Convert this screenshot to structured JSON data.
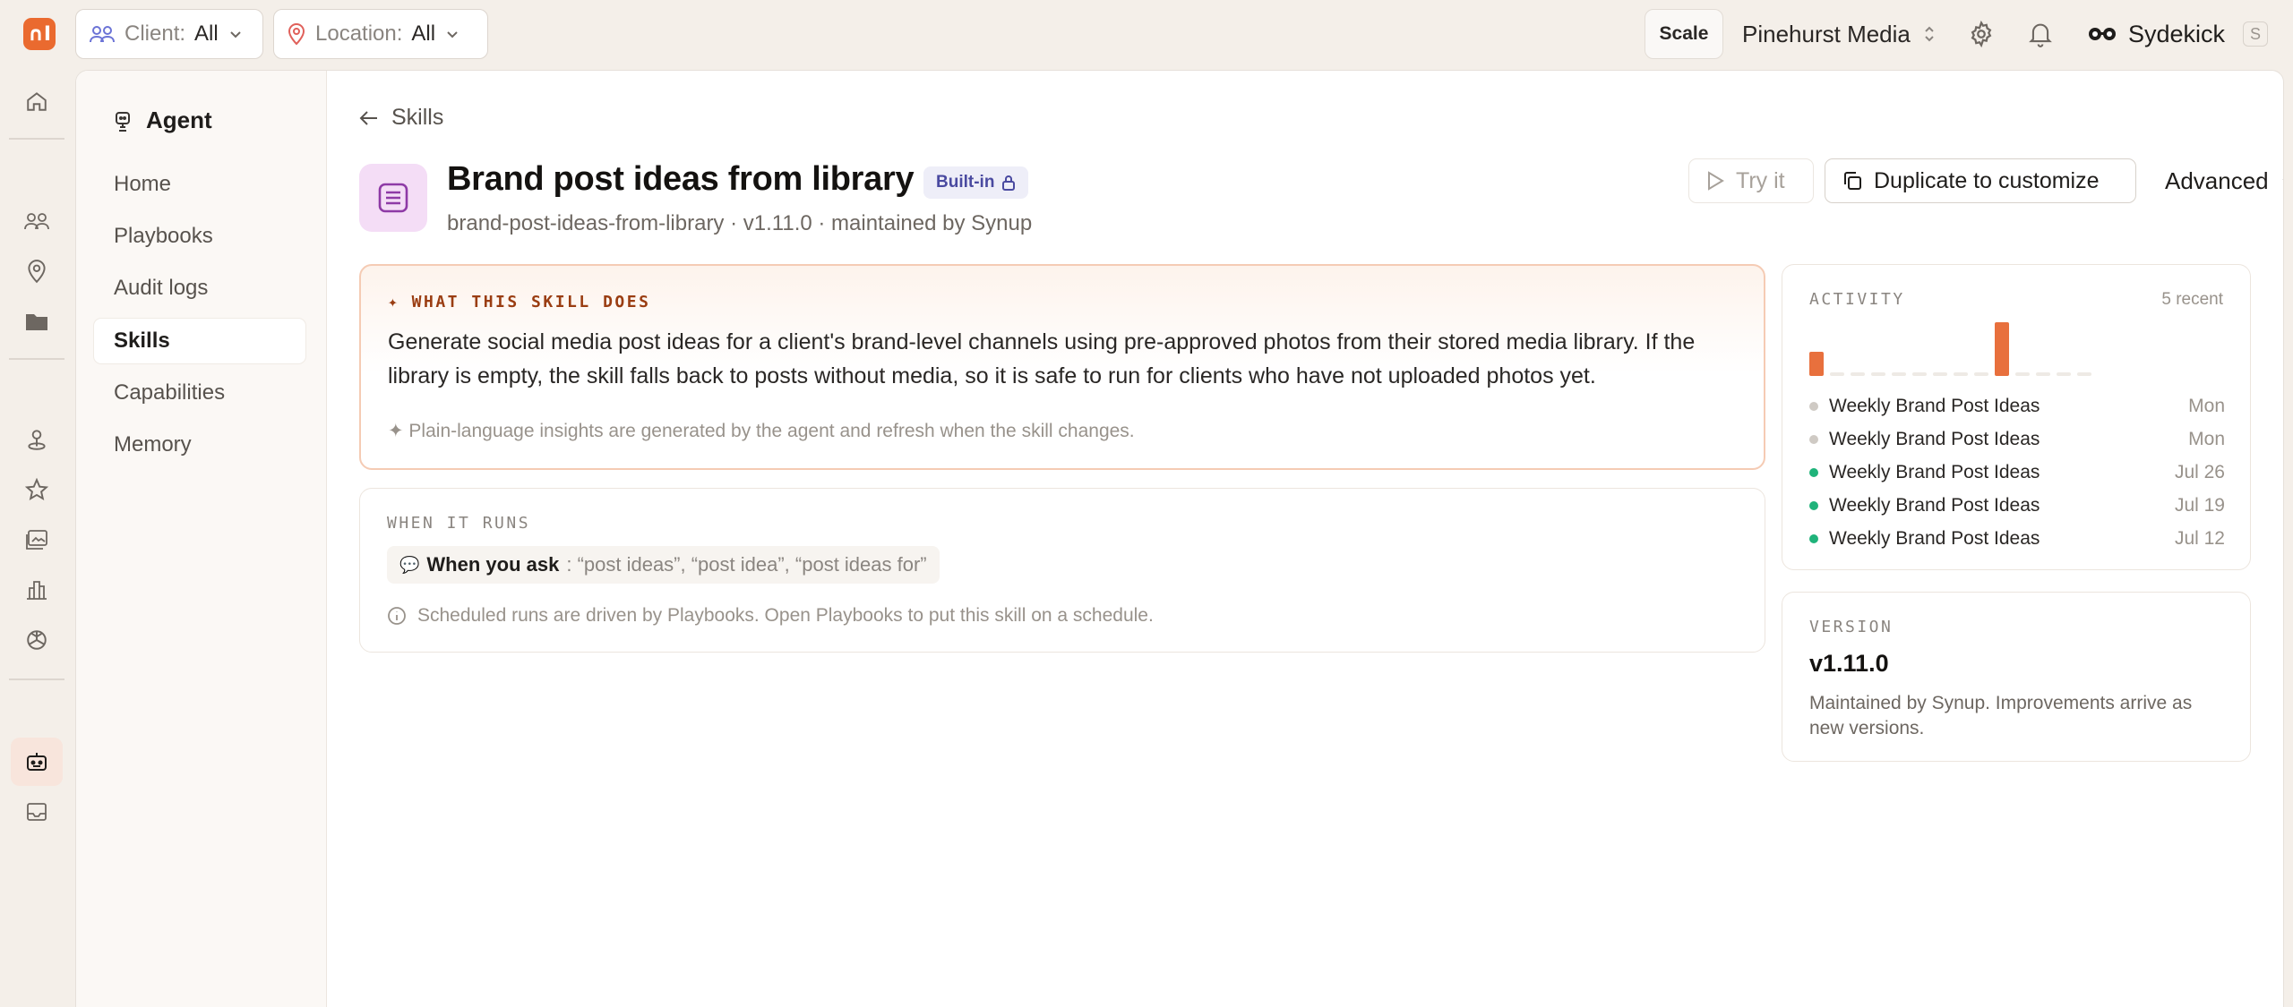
{
  "topbar": {
    "logo_text": "∩І",
    "client_label": "Client:",
    "client_value": "All",
    "location_label": "Location:",
    "location_value": "All",
    "scale_label": "Scale",
    "org_name": "Pinehurst Media",
    "assistant_name": "Sydekick",
    "assistant_shortcut": "S"
  },
  "subnav": {
    "title": "Agent",
    "items": [
      {
        "label": "Home"
      },
      {
        "label": "Playbooks"
      },
      {
        "label": "Audit logs"
      },
      {
        "label": "Skills"
      },
      {
        "label": "Capabilities"
      },
      {
        "label": "Memory"
      }
    ],
    "active_index": 3
  },
  "skill": {
    "back_label": "Skills",
    "title": "Brand post ideas from library",
    "badge": "Built-in",
    "meta": "brand-post-ideas-from-library · v1.11.0 · maintained by Synup",
    "try_label": "Try it",
    "duplicate_label": "Duplicate to customize",
    "advanced_label": "Advanced"
  },
  "what": {
    "heading": "✦ WHAT THIS SKILL DOES",
    "description": "Generate social media post ideas for a client's brand-level channels using pre-approved photos from their stored media library. If the library is empty, the skill falls back to posts without media, so it is safe to run for clients who have not uploaded photos yet.",
    "footnote": "✦ Plain-language insights are generated by the agent and refresh when the skill changes."
  },
  "runs": {
    "heading": "WHEN IT RUNS",
    "trigger_label": "When you ask",
    "trigger_phrases": ": “post ideas”, “post idea”, “post ideas for”",
    "footnote": "Scheduled runs are driven by Playbooks. Open Playbooks to put this skill on a schedule."
  },
  "activity": {
    "heading": "ACTIVITY",
    "recent_count": "5 recent",
    "spark_values": [
      0.45,
      0.06,
      0.06,
      0.06,
      0.06,
      0.06,
      0.06,
      0.06,
      0.06,
      1.0,
      0.06,
      0.06,
      0.06,
      0.06
    ],
    "spark_color": "#e8703d",
    "spark_empty_color": "#eeeae5",
    "items": [
      {
        "name": "Weekly Brand Post Ideas",
        "date": "Mon",
        "status": "pending"
      },
      {
        "name": "Weekly Brand Post Ideas",
        "date": "Mon",
        "status": "pending"
      },
      {
        "name": "Weekly Brand Post Ideas",
        "date": "Jul 26",
        "status": "success"
      },
      {
        "name": "Weekly Brand Post Ideas",
        "date": "Jul 19",
        "status": "success"
      },
      {
        "name": "Weekly Brand Post Ideas",
        "date": "Jul 12",
        "status": "success"
      }
    ],
    "status_colors": {
      "pending": "#cfcac4",
      "success": "#1fb37a"
    }
  },
  "version": {
    "heading": "VERSION",
    "number": "v1.11.0",
    "description": "Maintained by Synup. Improvements arrive as new versions."
  },
  "colors": {
    "accent": "#ea6a2f",
    "page_bg": "#f4efe9"
  }
}
